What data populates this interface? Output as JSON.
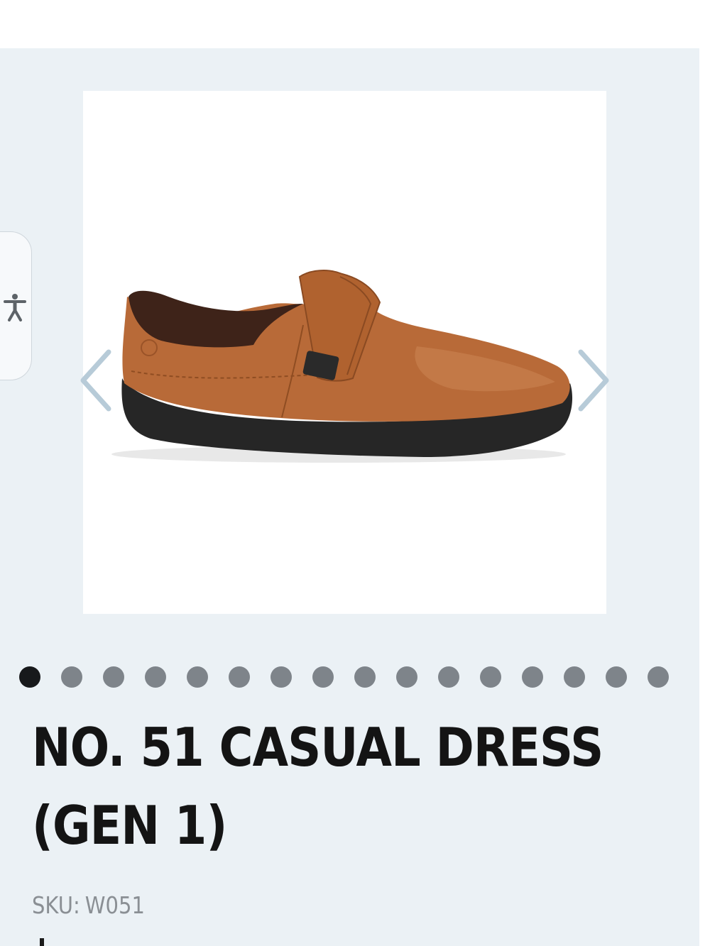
{
  "product": {
    "title_line1": "NO. 51 CASUAL DRESS",
    "title_line2": "(GEN 1)",
    "sku_label": "SKU:",
    "sku_value": "W051"
  },
  "gallery": {
    "image_count": 16,
    "active_index": 0,
    "image_subject": "brown leather slip-on shoe with strap",
    "prev_icon": "chevron-left-icon",
    "next_icon": "chevron-right-icon"
  },
  "accessibility": {
    "icon": "accessibility-person-icon"
  },
  "colors": {
    "page_background": "#ebf1f5",
    "arrow": "#b7cbd8",
    "dot_inactive": "#7e848a",
    "dot_active": "#17191b",
    "title": "#141414",
    "sku": "#8a8f94",
    "shoe_leather": "#b86a38",
    "shoe_sole": "#262626"
  }
}
